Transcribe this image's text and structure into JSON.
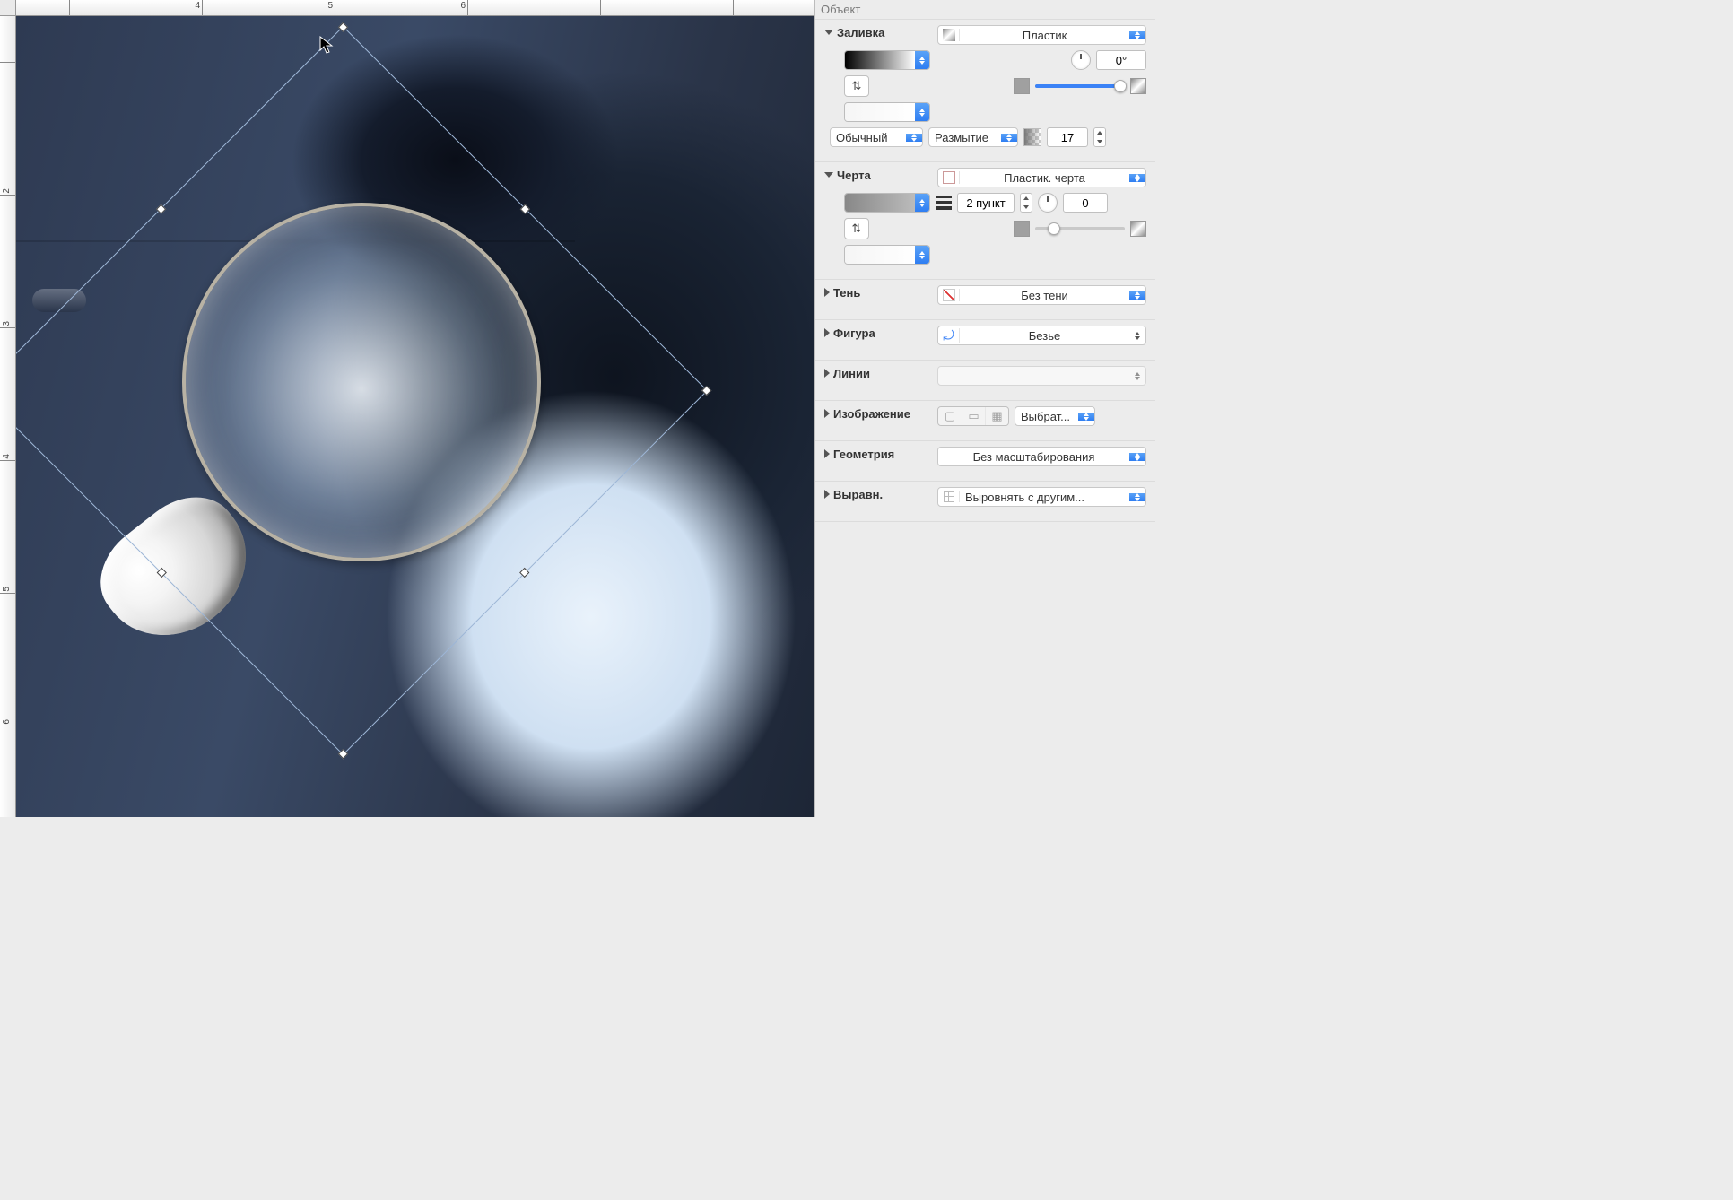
{
  "ruler_h": [
    "4",
    "5",
    "6"
  ],
  "ruler_v": [
    "2",
    "3",
    "4",
    "5",
    "6"
  ],
  "inspector": {
    "title": "Объект",
    "fill": {
      "label": "Заливка",
      "type": "Пластик",
      "angle": "0°",
      "blend_mode": "Обычный",
      "blur_label": "Размытие",
      "blur_value": "17"
    },
    "stroke": {
      "label": "Черта",
      "type": "Пластик. черта",
      "width": "2 пункт",
      "angle": "0"
    },
    "shadow": {
      "label": "Тень",
      "value": "Без тени"
    },
    "shape": {
      "label": "Фигура",
      "value": "Безье"
    },
    "lines": {
      "label": "Линии",
      "value": ""
    },
    "image": {
      "label": "Изображение",
      "value": "Выбрат..."
    },
    "geometry": {
      "label": "Геометрия",
      "value": "Без масштабирования"
    },
    "align": {
      "label": "Выравн.",
      "value": "Выровнять с другим..."
    }
  }
}
